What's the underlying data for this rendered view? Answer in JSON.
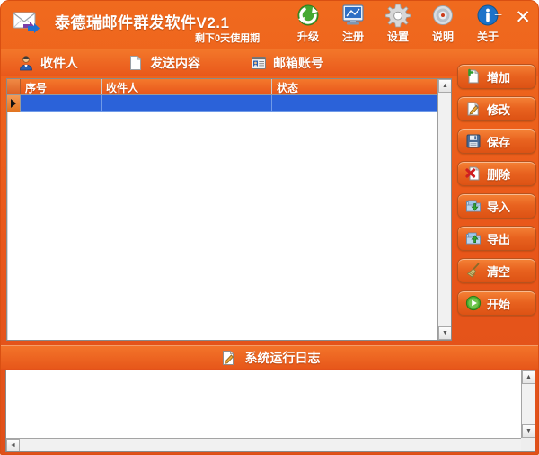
{
  "window": {
    "title": "泰德瑞邮件群发软件V2.1",
    "subtitle": "剩下0天使用期",
    "app_icon": "envelope-arrow-icon",
    "minimize_label": "–",
    "close_label": "✕",
    "accent_color": "#e8561a",
    "title_color": "#ffffff",
    "selection_color": "#2b62d9"
  },
  "toolbar": {
    "items": [
      {
        "label": "升级",
        "icon": "refresh-green-icon"
      },
      {
        "label": "注册",
        "icon": "monitor-blue-icon"
      },
      {
        "label": "设置",
        "icon": "gear-icon"
      },
      {
        "label": "说明",
        "icon": "cd-disc-icon"
      },
      {
        "label": "关于",
        "icon": "info-circle-icon"
      }
    ]
  },
  "tabs": [
    {
      "label": "收件人",
      "icon": "user-person-icon",
      "active": true
    },
    {
      "label": "发送内容",
      "icon": "document-page-icon",
      "active": false
    },
    {
      "label": "邮箱账号",
      "icon": "address-card-icon",
      "active": false
    }
  ],
  "grid": {
    "columns": [
      "序号",
      "收件人",
      "状态"
    ],
    "rows": [
      {
        "selected": true,
        "cells": [
          "",
          "",
          ""
        ]
      }
    ]
  },
  "side_buttons": [
    {
      "label": "增加",
      "icon": "add-document-icon"
    },
    {
      "label": "修改",
      "icon": "edit-pencil-icon"
    },
    {
      "label": "保存",
      "icon": "floppy-save-icon"
    },
    {
      "label": "删除",
      "icon": "delete-cross-icon"
    },
    {
      "label": "导入",
      "icon": "import-folder-down-icon"
    },
    {
      "label": "导出",
      "icon": "export-folder-up-icon"
    },
    {
      "label": "清空",
      "icon": "broom-clear-icon"
    },
    {
      "label": "开始",
      "icon": "play-start-icon"
    }
  ],
  "log": {
    "header": "系统运行日志",
    "header_icon": "log-note-icon",
    "content": ""
  },
  "scrollbars": {
    "up_arrow": "▲",
    "down_arrow": "▼",
    "left_arrow": "◄",
    "right_arrow": "►"
  }
}
